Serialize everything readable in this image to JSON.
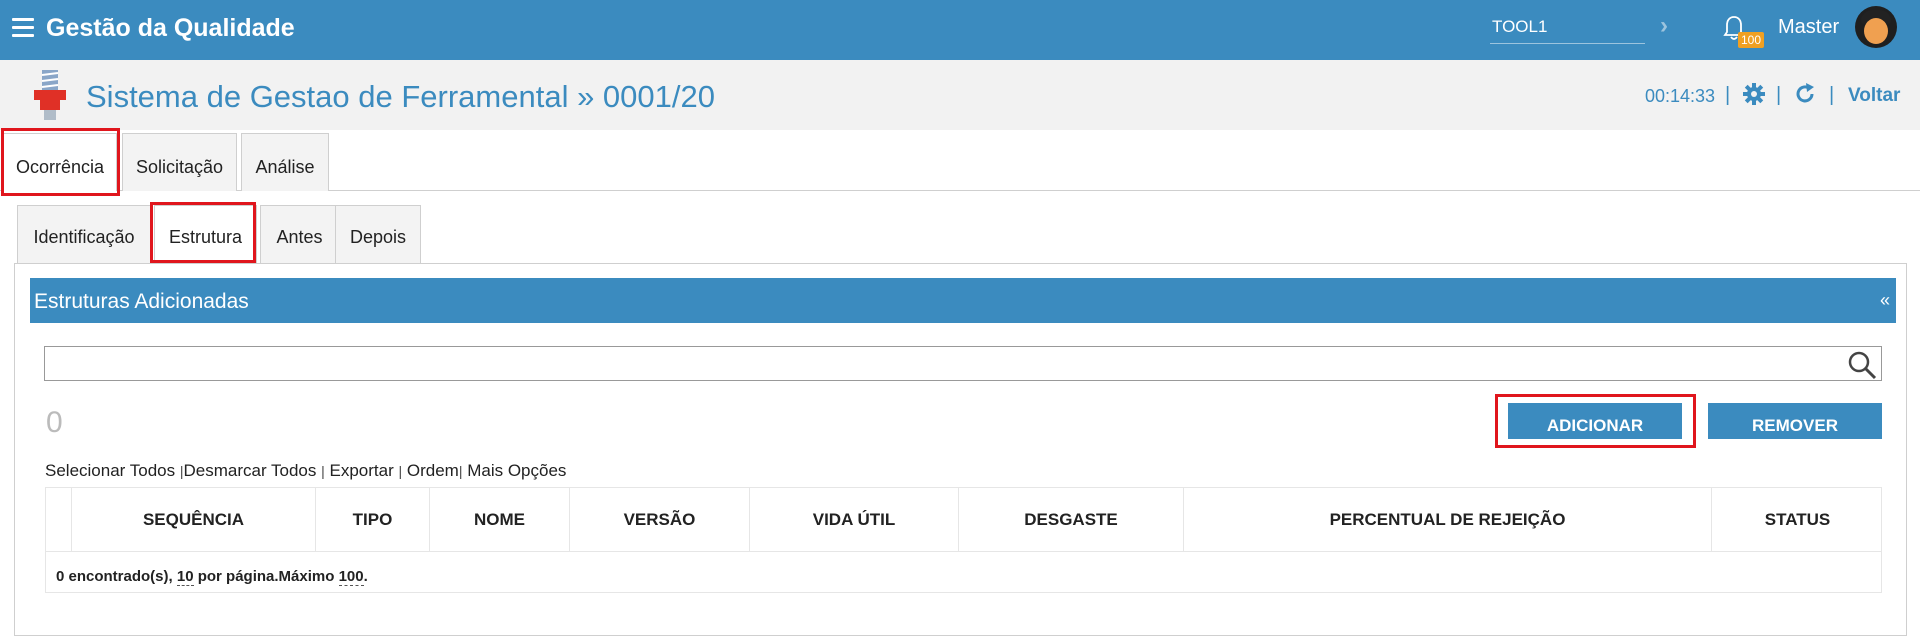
{
  "topbar": {
    "app_title": "Gestão da Qualidade",
    "search_value": "TOOL1",
    "notification_count": "100",
    "user_name": "Master"
  },
  "subheader": {
    "page_title": "Sistema de Gestao de Ferramental » 0001/20",
    "timer": "00:14:33",
    "back_label": "Voltar"
  },
  "tabs_primary": [
    {
      "label": "Ocorrência"
    },
    {
      "label": "Solicitação"
    },
    {
      "label": "Análise"
    }
  ],
  "tabs_secondary": [
    {
      "label": "Identificação"
    },
    {
      "label": "Estrutura"
    },
    {
      "label": "Antes"
    },
    {
      "label": "Depois"
    }
  ],
  "panel": {
    "title": "Estruturas Adicionadas",
    "collapse_label": "«",
    "search_value": "",
    "count": "0",
    "add_label": "ADICIONAR",
    "remove_label": "REMOVER",
    "links": {
      "select_all": "Selecionar Todos",
      "deselect_all": "Desmarcar Todos",
      "export": "Exportar",
      "order": "Ordem",
      "more": "Mais Opções"
    }
  },
  "grid": {
    "columns": [
      "SEQUÊNCIA",
      "TIPO",
      "NOME",
      "VERSÃO",
      "VIDA ÚTIL",
      "DESGASTE",
      "PERCENTUAL DE REJEIÇÃO",
      "STATUS"
    ],
    "footer": {
      "found": "0 encontrado(s),",
      "per_page_value": "10",
      "per_page_text": "por página.Máximo",
      "max_value": "100",
      "end": "."
    }
  },
  "colors": {
    "primary": "#3b8bbf",
    "highlight": "#e0161d",
    "badge": "#f0a022"
  }
}
